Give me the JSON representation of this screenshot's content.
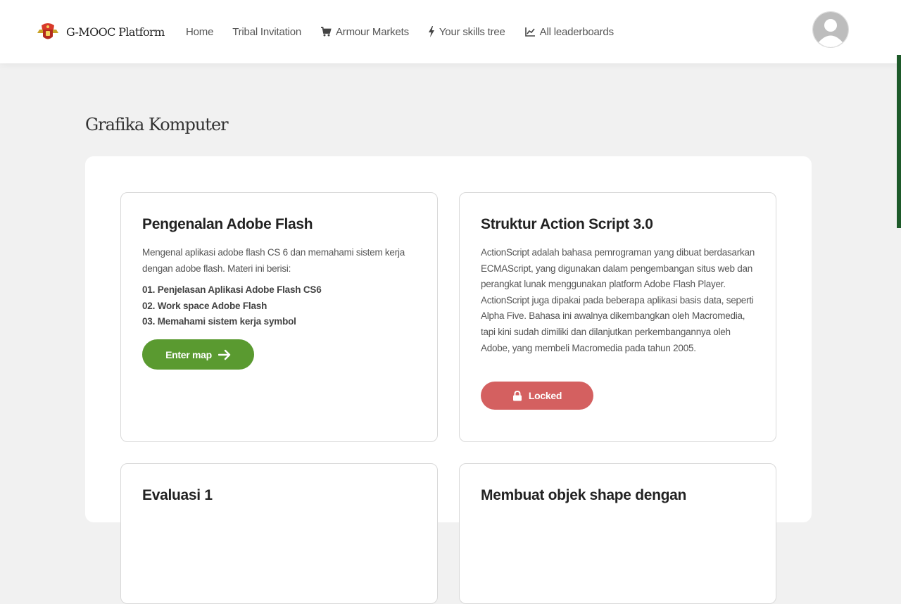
{
  "nav": {
    "brand": "G-MOOC Platform",
    "links": [
      {
        "label": "Home",
        "icon": ""
      },
      {
        "label": "Tribal Invitation",
        "icon": ""
      },
      {
        "label": "Armour Markets",
        "icon": "cart-icon"
      },
      {
        "label": "Your skills tree",
        "icon": "bolt-icon"
      },
      {
        "label": "All leaderboards",
        "icon": "chart-line-icon"
      }
    ],
    "avatar_icon": "user-avatar-icon"
  },
  "page": {
    "title": "Grafika Komputer"
  },
  "cards": [
    {
      "title": "Pengenalan Adobe Flash",
      "description": "Mengenal aplikasi adobe flash CS 6 dan memahami sistem kerja dengan adobe flash. Materi ini berisi:",
      "items": [
        "01. Penjelasan Aplikasi Adobe Flash CS6",
        "02. Work space Adobe Flash",
        "03. Memahami sistem kerja symbol"
      ],
      "button": {
        "label": "Enter map",
        "icon": "arrow-right-icon",
        "color": "#5a9a30"
      }
    },
    {
      "title": "Struktur Action Script 3.0",
      "description": "ActionScript adalah bahasa pemrograman yang dibuat berdasarkan ECMAScript, yang digunakan dalam pengembangan situs web dan perangkat lunak menggunakan platform Adobe Flash Player. ActionScript juga dipakai pada beberapa aplikasi basis data, seperti Alpha Five. Bahasa ini awalnya dikembangkan oleh Macromedia, tapi kini sudah dimiliki dan dilanjutkan perkembangannya oleh Adobe, yang membeli Macromedia pada tahun 2005.",
      "button": {
        "label": "Locked",
        "icon": "lock-icon",
        "color": "#d46060"
      }
    },
    {
      "title": "Evaluasi 1"
    },
    {
      "title": "Membuat objek shape dengan"
    }
  ],
  "colors": {
    "accent_green": "#5a9a30",
    "locked_red": "#d46060",
    "scrollbar_green": "#1e5a2a"
  }
}
